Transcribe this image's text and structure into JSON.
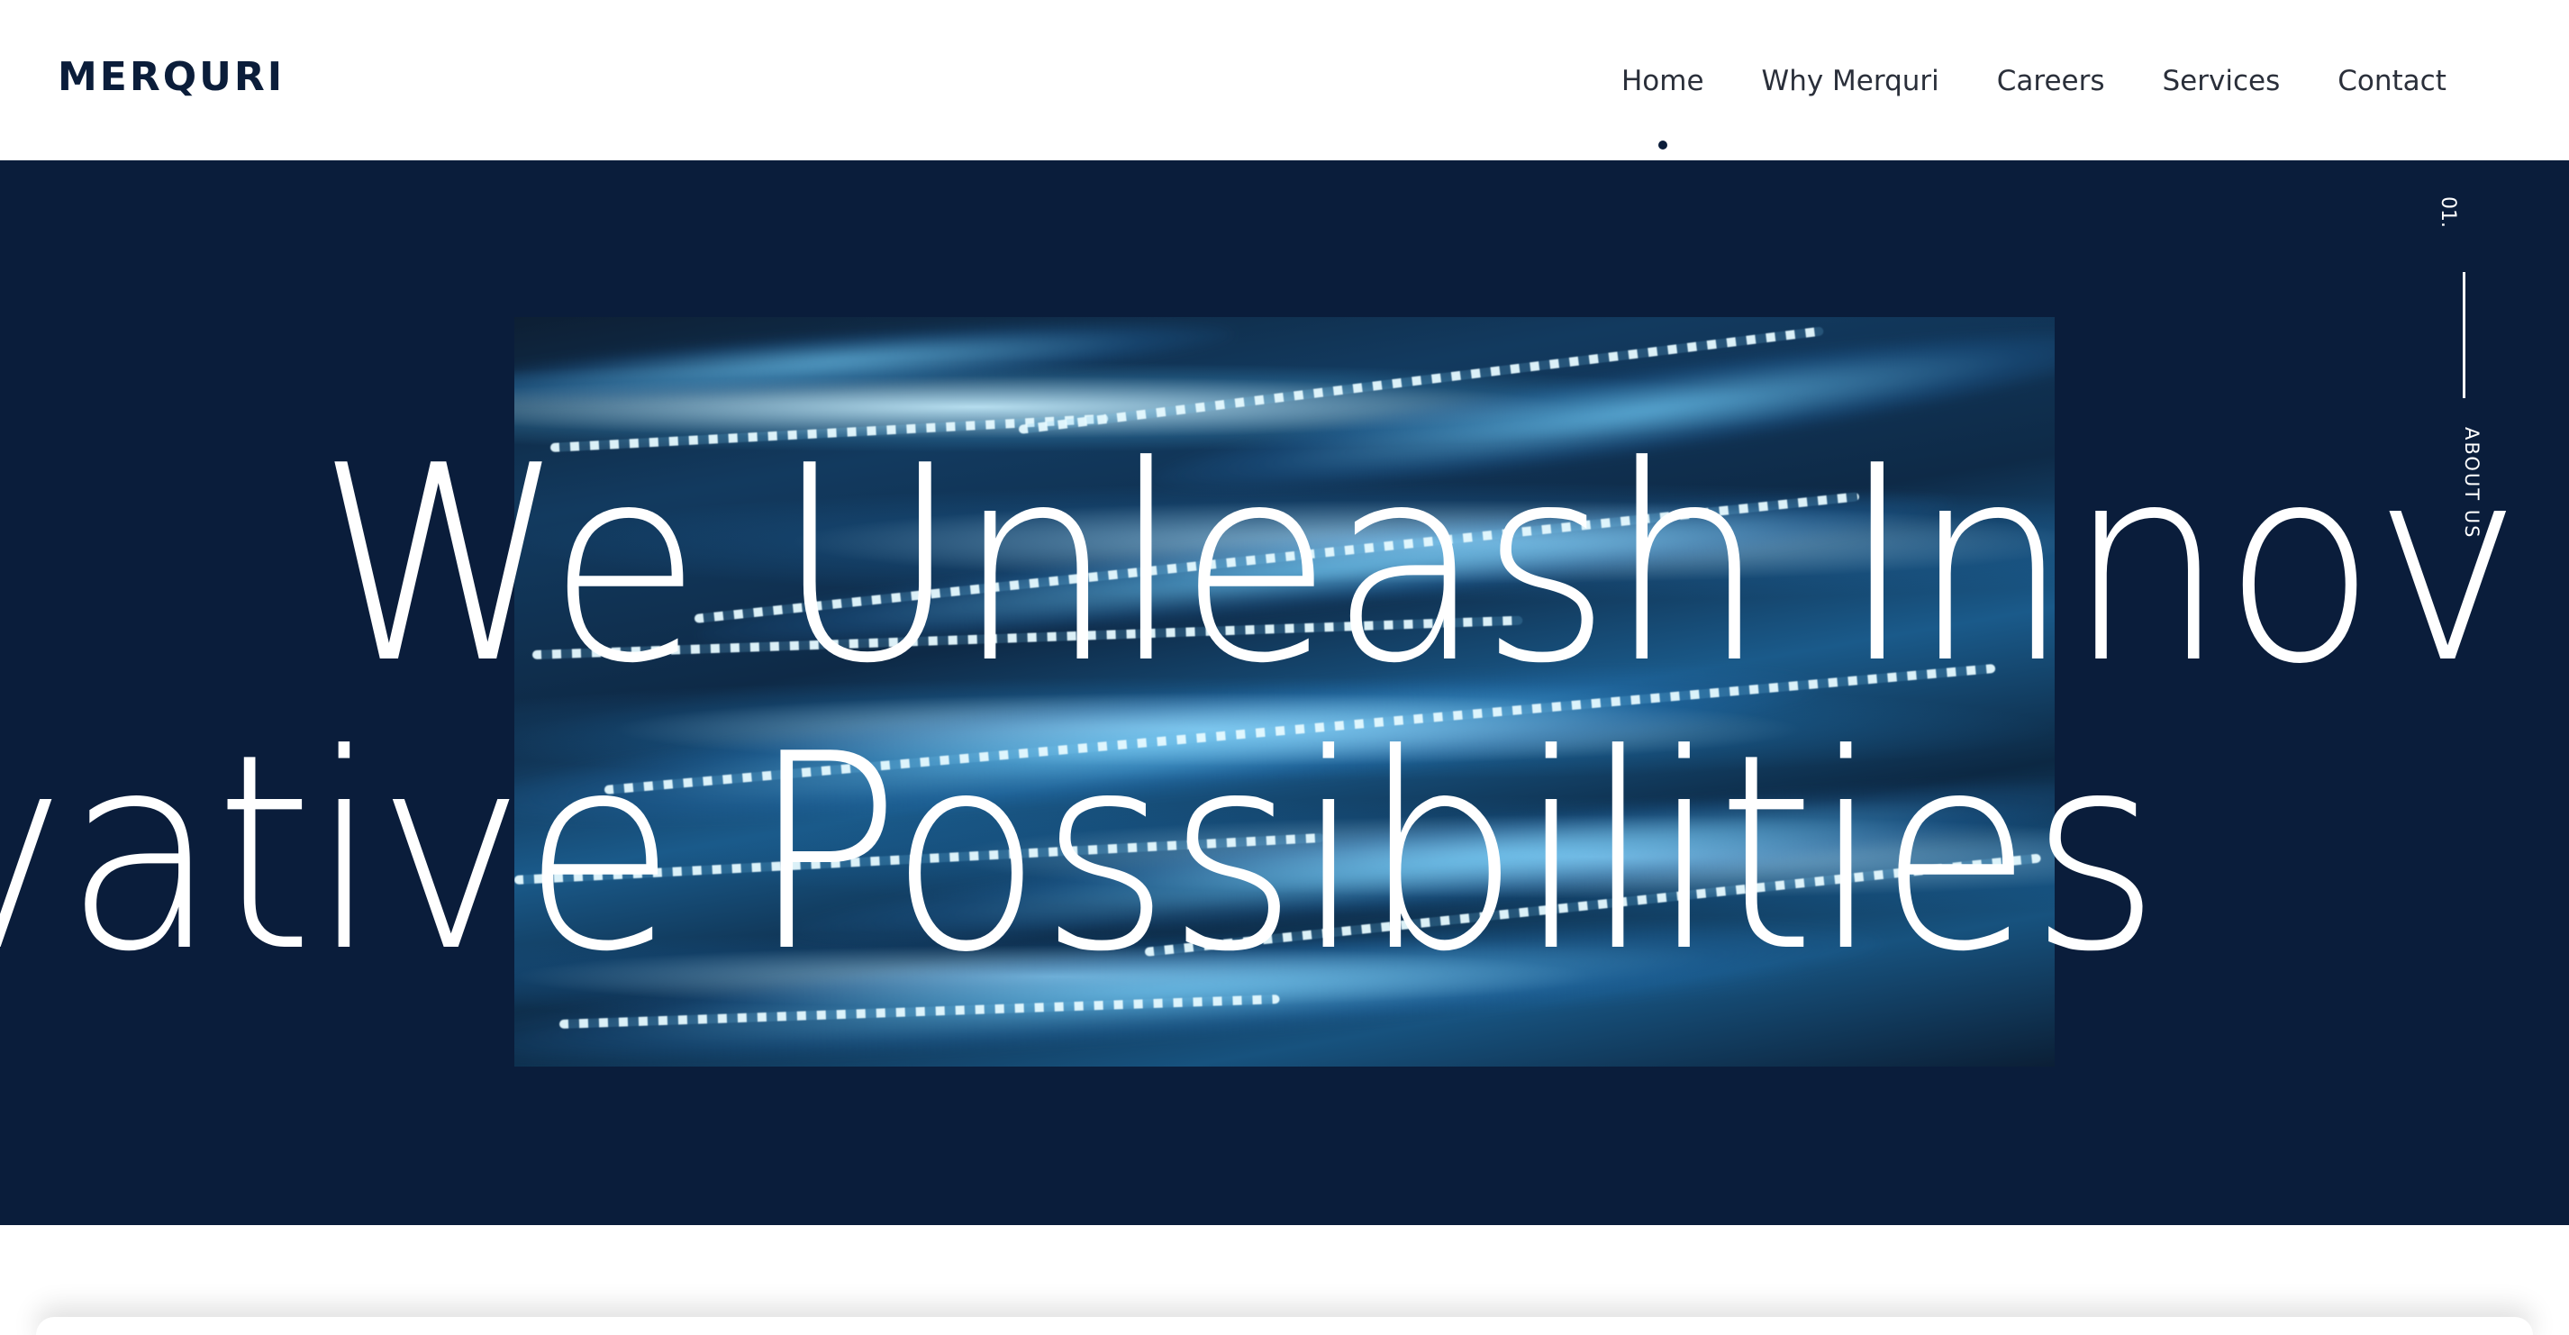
{
  "brand": {
    "logo_text": "MERQURI"
  },
  "nav": {
    "items": [
      {
        "label": "Home",
        "active": true
      },
      {
        "label": "Why Merquri",
        "active": false
      },
      {
        "label": "Careers",
        "active": false
      },
      {
        "label": "Services",
        "active": false
      },
      {
        "label": "Contact",
        "active": false
      }
    ]
  },
  "hero": {
    "headline_line1": "We Unleash Innov",
    "headline_line2": "vative Possibilities",
    "side_number": "01.",
    "side_label": "ABOUT US",
    "image_icon": "light-streaks-image"
  },
  "colors": {
    "brand_navy": "#0a1d3b",
    "text_white": "#ffffff",
    "nav_text": "#2a2f3a"
  }
}
